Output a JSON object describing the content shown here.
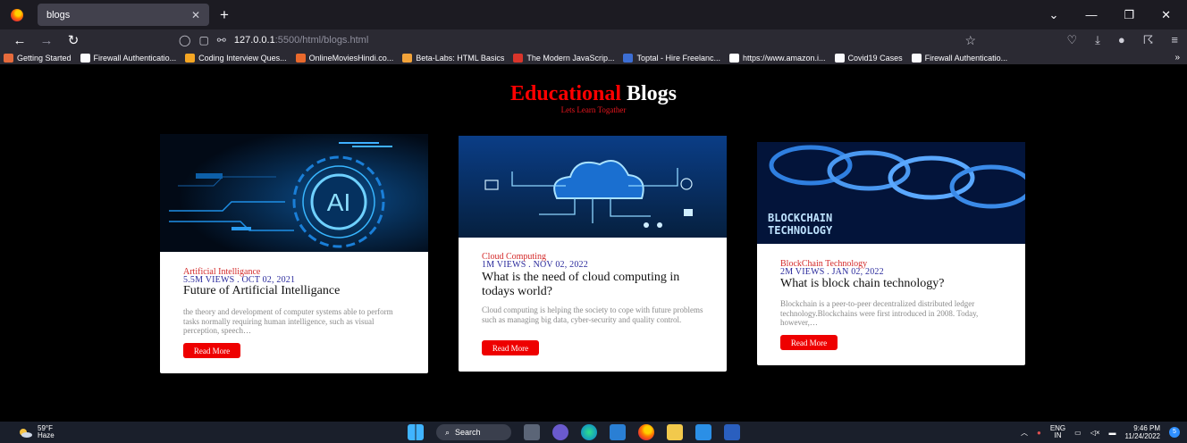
{
  "browser": {
    "tab_title": "blogs",
    "url_host": "127.0.0.1",
    "url_path": ":5500/html/blogs.html",
    "bookmarks": [
      {
        "label": "Getting Started",
        "color": "#e66b3c"
      },
      {
        "label": "Firewall Authenticatio...",
        "color": "#fbfbfe"
      },
      {
        "label": "Coding Interview Ques...",
        "color": "#f5a623"
      },
      {
        "label": "OnlineMoviesHindi.co...",
        "color": "#e9692c"
      },
      {
        "label": "Beta-Labs: HTML Basics",
        "color": "#f2a33a"
      },
      {
        "label": "The Modern JavaScrip...",
        "color": "#d9352b"
      },
      {
        "label": "Toptal - Hire Freelanc...",
        "color": "#3c6ed4"
      },
      {
        "label": "https://www.amazon.i...",
        "color": "#ffffff"
      },
      {
        "label": "Covid19 Cases",
        "color": "#fbfbfe"
      },
      {
        "label": "Firewall Authenticatio...",
        "color": "#fbfbfe"
      }
    ]
  },
  "page": {
    "heading_red": "Educational",
    "heading_white": "Blogs",
    "tagline": "Lets Learn Togather"
  },
  "cards": [
    {
      "category": "Artificial Intelligance",
      "meta": "5.5M VIEWS . OCT 02, 2021",
      "title": "Future of Artificial Intelligance",
      "desc": "the theory and development of computer systems able to perform tasks normally requiring human intelligence, such as visual perception, speech…",
      "button": "Read More",
      "image_text": "AI"
    },
    {
      "category": "Cloud Computing",
      "meta": "1M VIEWS . NOV 02, 2022",
      "title": "What is the need of cloud computing in todays world?",
      "desc": "Cloud computing is helping the society to cope with future problems such as managing big data, cyber-security and quality control.",
      "button": "Read More",
      "image_text": ""
    },
    {
      "category": "BlockChain Technology",
      "meta": "2M VIEWS . JAN 02, 2022",
      "title": "What is block chain technology?",
      "desc": "Blockchain is a peer-to-peer decentralized distributed ledger technology.Blockchains were first introduced in 2008. Today, however,…",
      "button": "Read More",
      "image_text": "BLOCKCHAIN TECHNOLOGY"
    }
  ],
  "taskbar": {
    "temp": "59°F",
    "weather": "Haze",
    "search": "Search",
    "lang_top": "ENG",
    "lang_bottom": "IN",
    "time": "9:46 PM",
    "date": "11/24/2022",
    "notifications": "5"
  }
}
